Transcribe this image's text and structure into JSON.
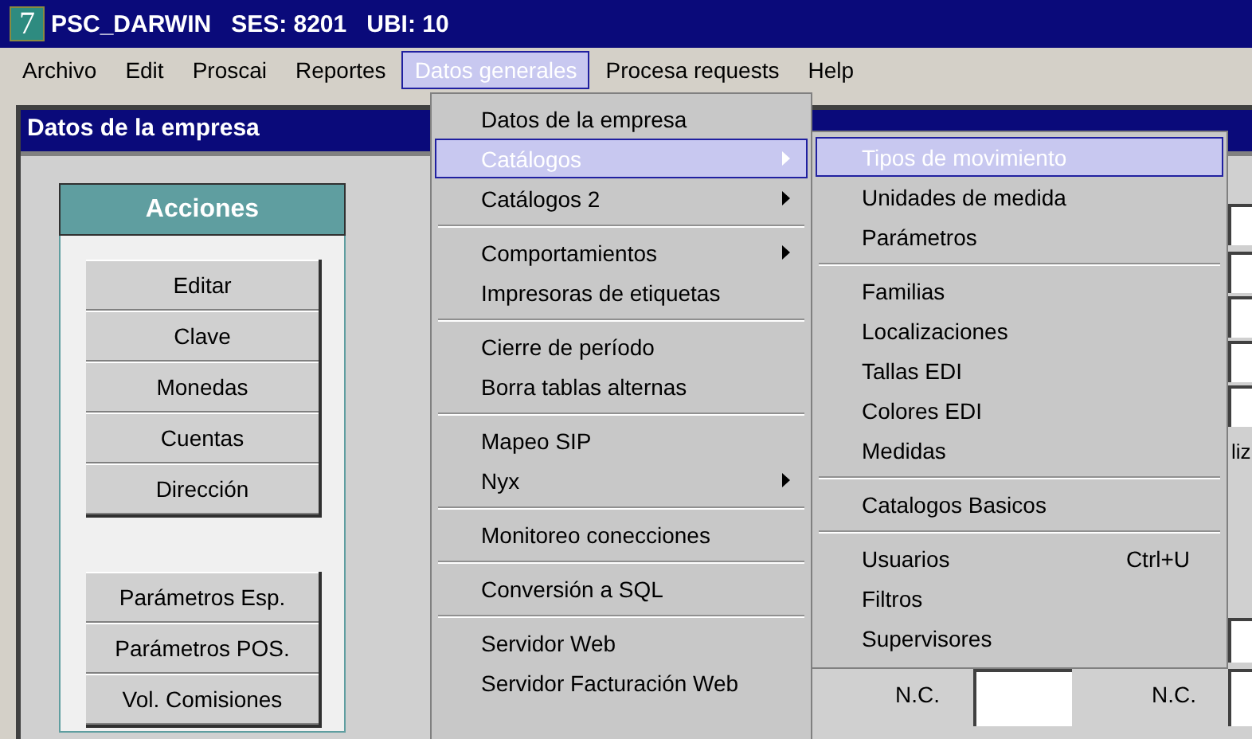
{
  "window": {
    "icon_text": "7",
    "title": "PSC_DARWIN   SES: 8201   UBI: 10"
  },
  "menu_bar": [
    {
      "label": "Archivo",
      "selected": false
    },
    {
      "label": "Edit",
      "selected": false
    },
    {
      "label": "Proscai",
      "selected": false
    },
    {
      "label": "Reportes",
      "selected": false
    },
    {
      "label": "Datos generales",
      "selected": true
    },
    {
      "label": "Procesa requests",
      "selected": false
    },
    {
      "label": "Help",
      "selected": false
    }
  ],
  "form": {
    "title": "Datos de la empresa",
    "actions_title": "Acciones",
    "action_buttons": [
      "Editar",
      "Clave",
      "Monedas",
      "Cuentas",
      "Dirección"
    ],
    "extra_buttons": [
      "Parámetros Esp.",
      "Parámetros POS.",
      "Vol. Comisiones"
    ],
    "label_fragment": "liz",
    "nc_labels": [
      "N.C.",
      "N.C."
    ]
  },
  "dropdown": [
    {
      "kind": "item",
      "label": "Datos de la empresa",
      "submenu": false,
      "selected": false
    },
    {
      "kind": "item",
      "label": "Catálogos",
      "submenu": true,
      "selected": true
    },
    {
      "kind": "item",
      "label": "Catálogos 2",
      "submenu": true,
      "selected": false
    },
    {
      "kind": "separator"
    },
    {
      "kind": "item",
      "label": "Comportamientos",
      "submenu": true,
      "selected": false
    },
    {
      "kind": "item",
      "label": "Impresoras de etiquetas",
      "submenu": false,
      "selected": false
    },
    {
      "kind": "separator"
    },
    {
      "kind": "item",
      "label": "Cierre de período",
      "submenu": false,
      "selected": false
    },
    {
      "kind": "item",
      "label": "Borra tablas alternas",
      "submenu": false,
      "selected": false
    },
    {
      "kind": "separator"
    },
    {
      "kind": "item",
      "label": "Mapeo SIP",
      "submenu": false,
      "selected": false
    },
    {
      "kind": "item",
      "label": "Nyx",
      "submenu": true,
      "selected": false
    },
    {
      "kind": "separator"
    },
    {
      "kind": "item",
      "label": "Monitoreo conecciones",
      "submenu": false,
      "selected": false
    },
    {
      "kind": "separator"
    },
    {
      "kind": "item",
      "label": "Conversión a SQL",
      "submenu": false,
      "selected": false
    },
    {
      "kind": "separator"
    },
    {
      "kind": "item",
      "label": "Servidor Web",
      "submenu": false,
      "selected": false
    },
    {
      "kind": "item",
      "label": "Servidor Facturación Web",
      "submenu": false,
      "selected": false
    }
  ],
  "submenu": [
    {
      "kind": "item",
      "label": "Tipos de movimiento",
      "selected": true
    },
    {
      "kind": "item",
      "label": "Unidades de medida",
      "selected": false
    },
    {
      "kind": "item",
      "label": "Parámetros",
      "selected": false
    },
    {
      "kind": "separator"
    },
    {
      "kind": "item",
      "label": "Familias",
      "selected": false
    },
    {
      "kind": "item",
      "label": "Localizaciones",
      "selected": false
    },
    {
      "kind": "item",
      "label": "Tallas EDI",
      "selected": false
    },
    {
      "kind": "item",
      "label": "Colores EDI",
      "selected": false
    },
    {
      "kind": "item",
      "label": "Medidas",
      "selected": false
    },
    {
      "kind": "separator"
    },
    {
      "kind": "item",
      "label": "Catalogos Basicos",
      "selected": false
    },
    {
      "kind": "separator"
    },
    {
      "kind": "item",
      "label": "Usuarios",
      "shortcut": "Ctrl+U",
      "selected": false
    },
    {
      "kind": "item",
      "label": "Filtros",
      "selected": false
    },
    {
      "kind": "item",
      "label": "Supervisores",
      "selected": false
    }
  ]
}
